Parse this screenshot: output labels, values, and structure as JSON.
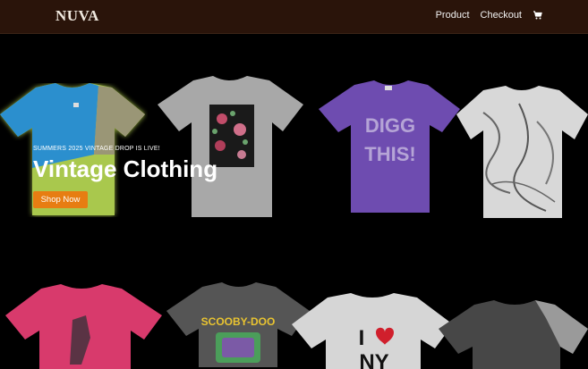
{
  "nav": {
    "logo": "NUVA",
    "links": [
      {
        "label": "Product"
      },
      {
        "label": "Checkout"
      }
    ],
    "cart_icon": "cart-icon"
  },
  "hero": {
    "eyebrow": "SUMMERS 2025 VINTAGE DROP IS LIVE!",
    "headline": "Vintage Clothing",
    "cta_label": "Shop Now"
  },
  "shirts_row1": [
    {
      "name": "tshirt-blue-yellow"
    },
    {
      "name": "tshirt-grey-floral"
    },
    {
      "name": "tshirt-purple-digg"
    },
    {
      "name": "tshirt-white-marble"
    }
  ],
  "shirts_row2": [
    {
      "name": "tshirt-pink"
    },
    {
      "name": "tshirt-scooby-doo"
    },
    {
      "name": "tshirt-i-love-ny"
    },
    {
      "name": "tshirt-grey-raglan"
    }
  ],
  "shirt_text": {
    "digg_line1": "DIGG",
    "digg_line2": "THIS!",
    "scooby": "SCOOBY-DOO",
    "ny_i": "I",
    "ny_ny": "NY"
  },
  "colors": {
    "nav_bg": "#2a140a",
    "accent": "#e77d12"
  }
}
